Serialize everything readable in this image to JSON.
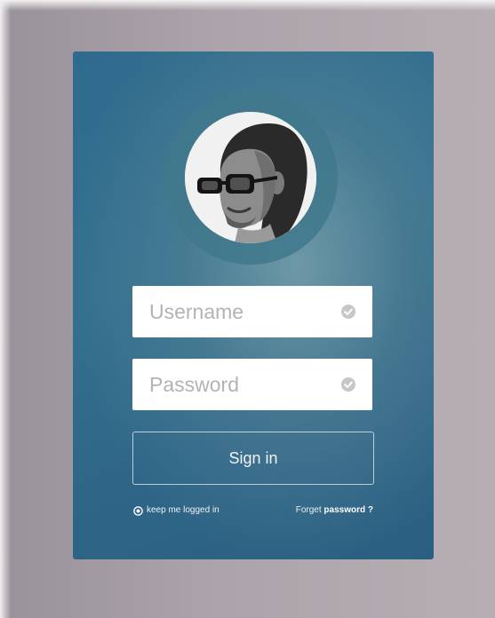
{
  "login": {
    "username_placeholder": "Username",
    "password_placeholder": "Password",
    "signin_label": "Sign in",
    "remember_label": "keep me logged in",
    "forget_prefix": "Forget",
    "forget_link": "password ?"
  },
  "colors": {
    "card_blue": "#2f6b8e",
    "ring_teal": "#41788c",
    "field_white": "#ffffff",
    "check_gray": "#c7c7c7",
    "background": "#aca4aa"
  },
  "icons": {
    "field_check": "check-circle-icon",
    "remember_radio": "radio-icon"
  }
}
